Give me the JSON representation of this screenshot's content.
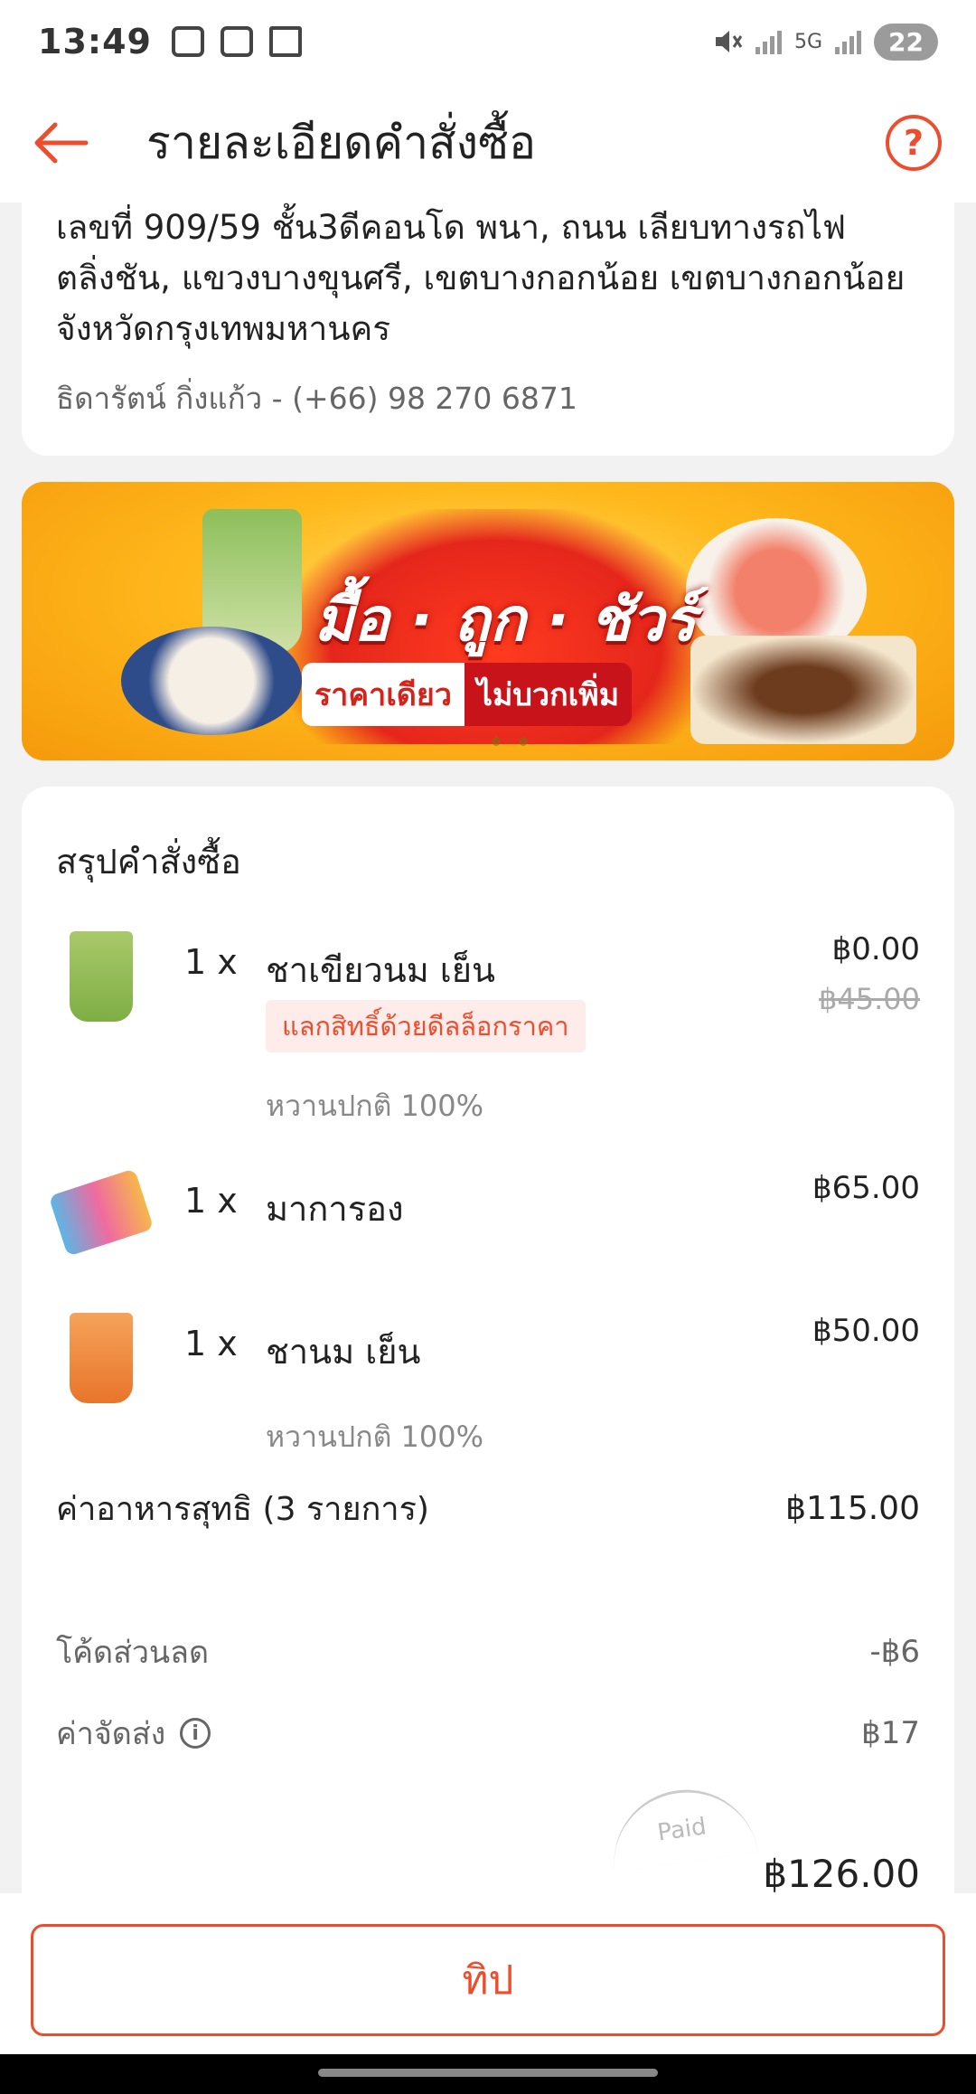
{
  "status_bar": {
    "time": "13:49",
    "network": "5G",
    "battery": "22",
    "icons": [
      "screenshot-icon",
      "voicemail-icon",
      "gmail-icon",
      "mute-icon",
      "signal-icon",
      "signal-icon"
    ]
  },
  "header": {
    "title": "รายละเอียดคำสั่งซื้อ",
    "back_icon": "back-arrow-icon",
    "help_label": "?"
  },
  "address": {
    "text": "เลขที่ 909/59 ชั้น3ดีคอนโด พนา, ถนน เลียบทางรถไฟตลิ่งชัน, แขวงบางขุนศรี, เขตบางกอกน้อย เขตบางกอกน้อย จังหวัดกรุงเทพมหานคร",
    "contact": "ธิดารัตน์ กิ่งแก้ว - (+66) 98 270 6871"
  },
  "banner": {
    "title": "มื้อ · ถูก · ชัวร์",
    "pill_left": "ราคาเดียว",
    "pill_right": "ไม่บวกเพิ่ม"
  },
  "summary": {
    "title": "สรุปคำสั่งซื้อ",
    "items": [
      {
        "qty": "1 x",
        "name": "ชาเขียวนม เย็น",
        "price": "฿0.00",
        "original_price": "฿45.00",
        "tag": "แลกสิทธิ์ด้วยดีลล็อกราคา",
        "option": "หวานปกติ 100%"
      },
      {
        "qty": "1 x",
        "name": "มาการอง",
        "price": "฿65.00"
      },
      {
        "qty": "1 x",
        "name": "ชานม เย็น",
        "price": "฿50.00",
        "option": "หวานปกติ 100%"
      }
    ],
    "subtotal_label": "ค่าอาหารสุทธิ (3 รายการ)",
    "subtotal_value": "฿115.00",
    "discount_label": "โค้ดส่วนลด",
    "discount_value": "-฿6",
    "delivery_label": "ค่าจัดส่ง",
    "delivery_value": "฿17",
    "paid_stamp": "Paid",
    "total_value": "฿126.00"
  },
  "tip_button": "ทิป",
  "colors": {
    "accent": "#ee4d2d",
    "tag_bg": "#fdecea"
  }
}
